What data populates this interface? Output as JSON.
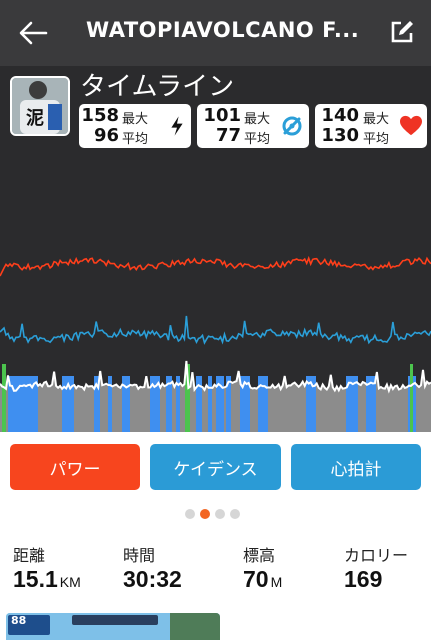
{
  "header": {
    "title": "WATOPIAVOLCANO F..."
  },
  "timeline": {
    "title": "タイムライン",
    "avatar_text": "泥",
    "stats": [
      {
        "max": "158",
        "max_label": "最大",
        "avg": "96",
        "avg_label": "平均",
        "icon": "lightning-icon"
      },
      {
        "max": "101",
        "max_label": "最大",
        "avg": "77",
        "avg_label": "平均",
        "icon": "cadence-icon"
      },
      {
        "max": "140",
        "max_label": "最大",
        "avg": "130",
        "avg_label": "平均",
        "icon": "heart-icon"
      }
    ]
  },
  "colors": {
    "power": "#ff3f1b",
    "cadence": "#2b9fd8",
    "heart": "#ef3324",
    "accent": "#f26522"
  },
  "tabs": [
    {
      "label": "パワー",
      "color": "#f7451e"
    },
    {
      "label": "ケイデンス",
      "color": "#2b9bd6"
    },
    {
      "label": "心拍計",
      "color": "#2b9bd6"
    }
  ],
  "pager": {
    "count": 4,
    "active": 1
  },
  "metrics": [
    {
      "label": "距離",
      "value": "15.1",
      "unit": "KM"
    },
    {
      "label": "時間",
      "value": "30:32",
      "unit": ""
    },
    {
      "label": "標高",
      "value": "70",
      "unit": "M"
    },
    {
      "label": "カロリー",
      "value": "169",
      "unit": ""
    }
  ],
  "thumbnail": {
    "speed": "88"
  }
}
